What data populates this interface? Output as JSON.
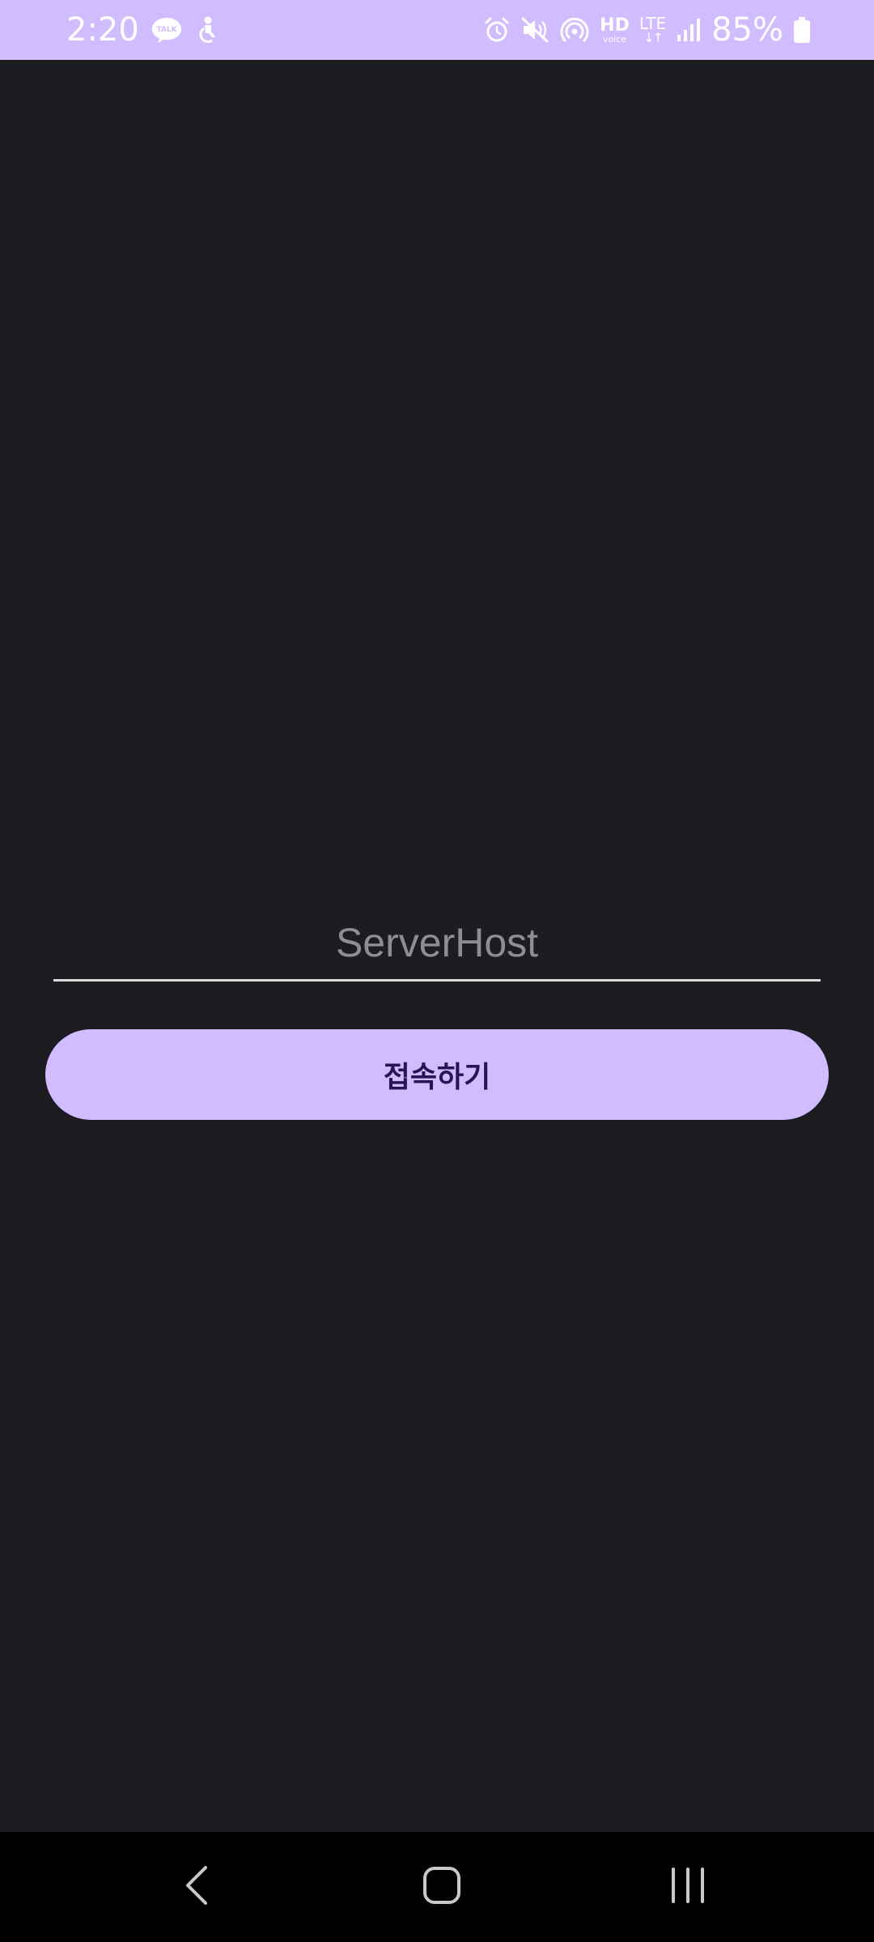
{
  "status_bar": {
    "time": "2:20",
    "notification_icons": [
      "kakaotalk-icon",
      "accessibility-icon"
    ],
    "system_icons": [
      "alarm-icon",
      "mute-icon",
      "hotspot-icon",
      "hd-voice-icon",
      "lte-icon",
      "signal-icon"
    ],
    "hd_label": "HD",
    "hd_sub_label": "voice",
    "lte_label": "LTE",
    "battery_percent": "85%",
    "background_color": "#d0bcff"
  },
  "main": {
    "server_input": {
      "placeholder": "ServerHost",
      "value": ""
    },
    "connect_button_label": "접속하기",
    "accent_color": "#d0bcff",
    "background_color": "#1d1c21"
  },
  "nav_bar": {
    "buttons": [
      "back-icon",
      "home-icon",
      "recents-icon"
    ]
  }
}
